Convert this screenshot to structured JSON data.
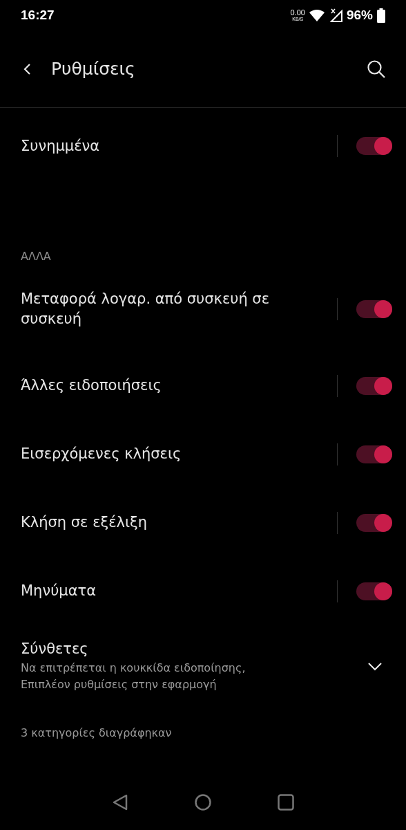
{
  "status_bar": {
    "time": "16:27",
    "net_speed": "0.00",
    "net_unit": "KB/S",
    "battery": "96%"
  },
  "header": {
    "title": "Ρυθμίσεις"
  },
  "top_rows": [
    {
      "label": "Συνημμένα",
      "on": true
    }
  ],
  "section": {
    "title": "ΑΛΛΑ",
    "rows": [
      {
        "label": "Μεταφορά λογαρ. από συσκευή σε συσκευή",
        "on": true
      },
      {
        "label": "Άλλες ειδοποιήσεις",
        "on": true
      },
      {
        "label": "Εισερχόμενες κλήσεις",
        "on": true
      },
      {
        "label": "Κλήση σε εξέλιξη",
        "on": true
      },
      {
        "label": "Μηνύματα",
        "on": true
      }
    ]
  },
  "advanced": {
    "title": "Σύνθετες",
    "summary": "Να επιτρέπεται η κουκκίδα ειδοποίησης, Επιπλέον ρυθμίσεις στην εφαρμογή",
    "expanded": false
  },
  "footer": "3 κατηγορίες διαγράφηκαν"
}
